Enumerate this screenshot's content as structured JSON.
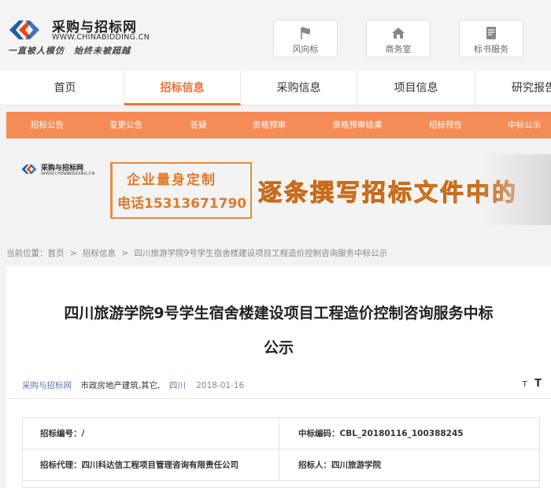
{
  "header": {
    "logo_cn": "采购与招标网",
    "logo_en": "WWW.CHINABIDDING.CN",
    "slogan": "一直被人模仿　始终未被超越",
    "buttons": [
      {
        "label": "风向标",
        "icon": "flag-icon"
      },
      {
        "label": "商务室",
        "icon": "home-icon"
      },
      {
        "label": "标书服务",
        "icon": "document-icon"
      }
    ]
  },
  "nav": {
    "items": [
      "首页",
      "招标信息",
      "采购信息",
      "项目信息",
      "研究报告"
    ],
    "active": "招标信息"
  },
  "subnav": {
    "items": [
      "招标公告",
      "变更公告",
      "答疑",
      "资格预审",
      "资格预审结果",
      "招标预告",
      "中标公示"
    ]
  },
  "banner": {
    "logo_cn": "采购与招标网",
    "logo_en": "WWW.CHINABIDDING.CN",
    "line1": "企业量身定制",
    "line2": "电话15313671790",
    "big_text": "逐条撰写招标文件中的",
    "accent": "#e07a2a"
  },
  "breadcrumb": {
    "label": "当前位置：",
    "items": [
      "首页",
      "招标信息",
      "四川旅游学院9号学生宿舍楼建设项目工程造价控制咨询服务中标公示"
    ],
    "sep": ">"
  },
  "article": {
    "title_line1": "四川旅游学院9号学生宿舍楼建设项目工程造价控制咨询服务中标",
    "title_line2": "公示",
    "source": "采购与招标网",
    "category": "市政房地产建筑,其它,",
    "region": "四川",
    "date": "2018-01-16",
    "font_small": "T",
    "font_large": "T"
  },
  "info": {
    "bid_no_label": "招标编号：/",
    "win_code_label": "中标编码：CBL_20180116_100388245",
    "agent_label": "招标代理：四川科达信工程项目管理咨询有限责任公司",
    "tenderer_label": "招标人：四川旅游学院"
  },
  "colors": {
    "brand_orange": "#f07234",
    "subnav_bg": "#f58c57",
    "link_blue": "#5a77a8"
  }
}
